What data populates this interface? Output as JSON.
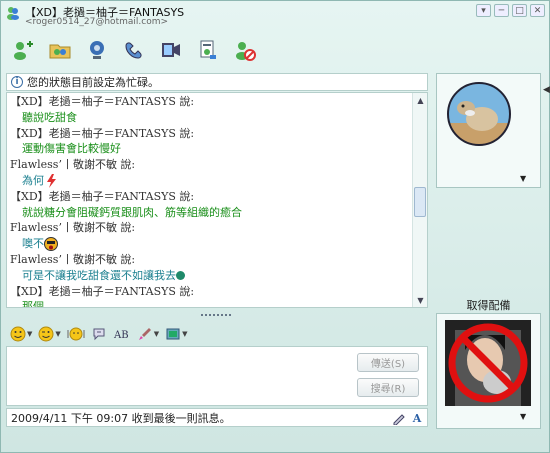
{
  "window": {
    "title": "【XD】老撾＝柚子＝FANTASYS",
    "subtitle": "<roger0514_27@hotmail.com>",
    "controls": [
      "▾",
      "─",
      "□",
      "✕"
    ]
  },
  "toolbar": {
    "icons": [
      "invite-contact-icon",
      "share-folder-icon",
      "webcam-icon",
      "call-icon",
      "video-icon",
      "file-transfer-icon",
      "block-icon"
    ]
  },
  "status_bar": {
    "text": "您的狀態目前設定為忙碌。"
  },
  "messages": [
    {
      "type": "sender",
      "text": "【XD】老撾＝柚子＝FANTASYS 說:"
    },
    {
      "type": "body",
      "text": "聽說吃甜食"
    },
    {
      "type": "sender",
      "text": "【XD】老撾＝柚子＝FANTASYS 說:"
    },
    {
      "type": "body",
      "text": "運動傷害會比較慢好"
    },
    {
      "type": "sender",
      "text": "Flawless’丨敬謝不敏 說:"
    },
    {
      "type": "body",
      "text": "為何",
      "emoticon": "lightning"
    },
    {
      "type": "sender",
      "text": "【XD】老撾＝柚子＝FANTASYS 說:"
    },
    {
      "type": "body",
      "text": "就說糖分會阻礙鈣質跟肌肉、筋等組織的癒合"
    },
    {
      "type": "sender",
      "text": "Flawless’丨敬謝不敏 說:"
    },
    {
      "type": "body",
      "text": "噢不",
      "emoticon": "shocked"
    },
    {
      "type": "sender",
      "text": "Flawless’丨敬謝不敏 說:"
    },
    {
      "type": "body",
      "text": "可是不讓我吃甜食還不如讓我去",
      "emoticon": "dot"
    },
    {
      "type": "sender",
      "text": "【XD】老撾＝柚子＝FANTASYS 說:"
    },
    {
      "type": "body",
      "text": "那個"
    }
  ],
  "format_toolbar": {
    "icons": [
      "emoticon-icon",
      "wink-icon",
      "nudge-icon",
      "voice-clip-icon",
      "font-icon",
      "background-icon",
      "color-icon"
    ]
  },
  "buttons": {
    "send": "傳送(S)",
    "search": "搜尋(R)"
  },
  "footer": {
    "last_message": "2009/4/11 下午 09:07 收到最後一則訊息。"
  },
  "right_panel": {
    "get_accessories": "取得配備"
  },
  "colors": {
    "sender": "#333333",
    "body_green": "#1a8f1a",
    "body_teal": "#1a7f8f",
    "window_bg": "#cfe6e2"
  }
}
